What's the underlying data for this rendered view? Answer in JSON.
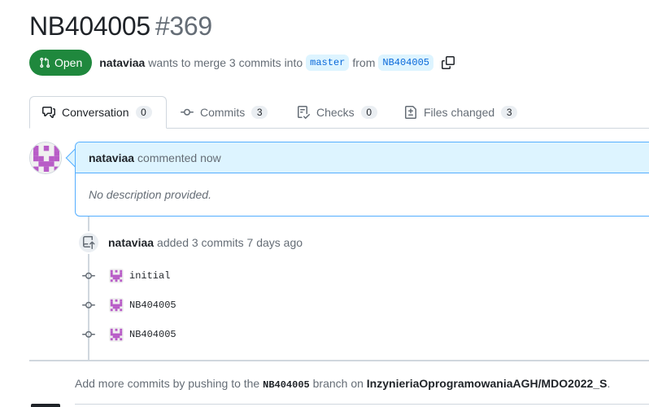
{
  "pr": {
    "title": "NB404005",
    "number": "#369",
    "state": "Open",
    "author": "nataviaa",
    "merge_text": "wants to merge 3 commits into",
    "base_branch": "master",
    "from_text": "from",
    "head_branch": "NB404005"
  },
  "tabs": [
    {
      "label": "Conversation",
      "count": "0",
      "icon": "comment-discussion-icon"
    },
    {
      "label": "Commits",
      "count": "3",
      "icon": "git-commit-icon"
    },
    {
      "label": "Checks",
      "count": "0",
      "icon": "checklist-icon"
    },
    {
      "label": "Files changed",
      "count": "3",
      "icon": "file-diff-icon"
    }
  ],
  "comment": {
    "author": "nataviaa",
    "action": "commented now",
    "body": "No description provided."
  },
  "push_event": {
    "author": "nataviaa",
    "text": "added 3 commits 7 days ago"
  },
  "commits": [
    {
      "message": "initial"
    },
    {
      "message": "NB404005"
    },
    {
      "message": "NB404005"
    }
  ],
  "footer": {
    "prefix": "Add more commits by pushing to the",
    "branch": "NB404005",
    "middle": "branch on",
    "repo": "InzynieriaOprogramowaniaAGH/MDO2022_S",
    "suffix": "."
  },
  "colors": {
    "open_green": "#1f883d",
    "link_blue": "#0969da",
    "comment_header_bg": "#ddf4ff",
    "identicon_purple": "#b85cc7"
  }
}
